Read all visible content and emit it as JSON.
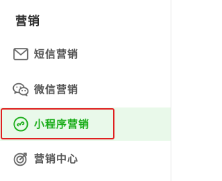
{
  "section": {
    "title": "营销"
  },
  "menu": {
    "items": [
      {
        "label": "短信营销",
        "icon": "mail-icon",
        "active": false
      },
      {
        "label": "微信营销",
        "icon": "wechat-icon",
        "active": false
      },
      {
        "label": "小程序营销",
        "icon": "mini-program-icon",
        "active": true
      },
      {
        "label": "营销中心",
        "icon": "target-icon",
        "active": false
      }
    ]
  },
  "colors": {
    "active_text": "#1aad19",
    "active_background": "#e9f9ea",
    "highlight_border": "#e02020",
    "text": "#555555",
    "title": "#2b2b2b"
  }
}
